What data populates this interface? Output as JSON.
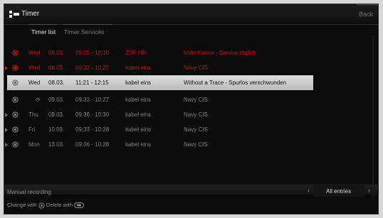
{
  "window": {
    "title": "Timer",
    "back_label": "Back"
  },
  "tabs": [
    {
      "label": "Timer list",
      "active": true
    },
    {
      "label": "Timer Services",
      "active": false
    }
  ],
  "timers": [
    {
      "day": "Wed",
      "date": "08.03.",
      "time": "09:05 - 10:30",
      "channel": "ZDF HD",
      "title": "Volle Kanne - Service täglich",
      "state": "red"
    },
    {
      "day": "Wed",
      "date": "08.03.",
      "time": "09:33 - 10:27",
      "channel": "kabel eins",
      "title": "Navy CIS",
      "state": "red"
    },
    {
      "day": "Wed",
      "date": "08.03.",
      "time": "11:21 - 12:15",
      "channel": "kabel eins",
      "title": "Without a Trace - Spurlos verschwunden",
      "state": "selected"
    },
    {
      "day": "",
      "date": "09.03.",
      "time": "09:33 - 10:27",
      "channel": "kabel eins",
      "title": "Navy CIS",
      "state": "dim",
      "repeat_icon": "⟳"
    },
    {
      "day": "Thu",
      "date": "09.03.",
      "time": "09:36 - 10:30",
      "channel": "kabel eins",
      "title": "Navy CIS",
      "state": "dim"
    },
    {
      "day": "Fri",
      "date": "10.03.",
      "time": "09:33 - 10:28",
      "channel": "kabel eins",
      "title": "Navy CIS",
      "state": "dim"
    },
    {
      "day": "Mon",
      "date": "13.03.",
      "time": "09:36 - 10:28",
      "channel": "kabel eins",
      "title": "Navy CIS",
      "state": "dim"
    }
  ],
  "footer": {
    "manual_recording": "Manual recording",
    "filter_label": "All entries",
    "filter_prev": "‹",
    "filter_next": "›",
    "hint_change": "Change with",
    "hint_delete": "Delete with"
  },
  "colors": {
    "record_red": "#b21c1c",
    "background": "#0b0b0b",
    "selected": "#d0d0d0"
  }
}
